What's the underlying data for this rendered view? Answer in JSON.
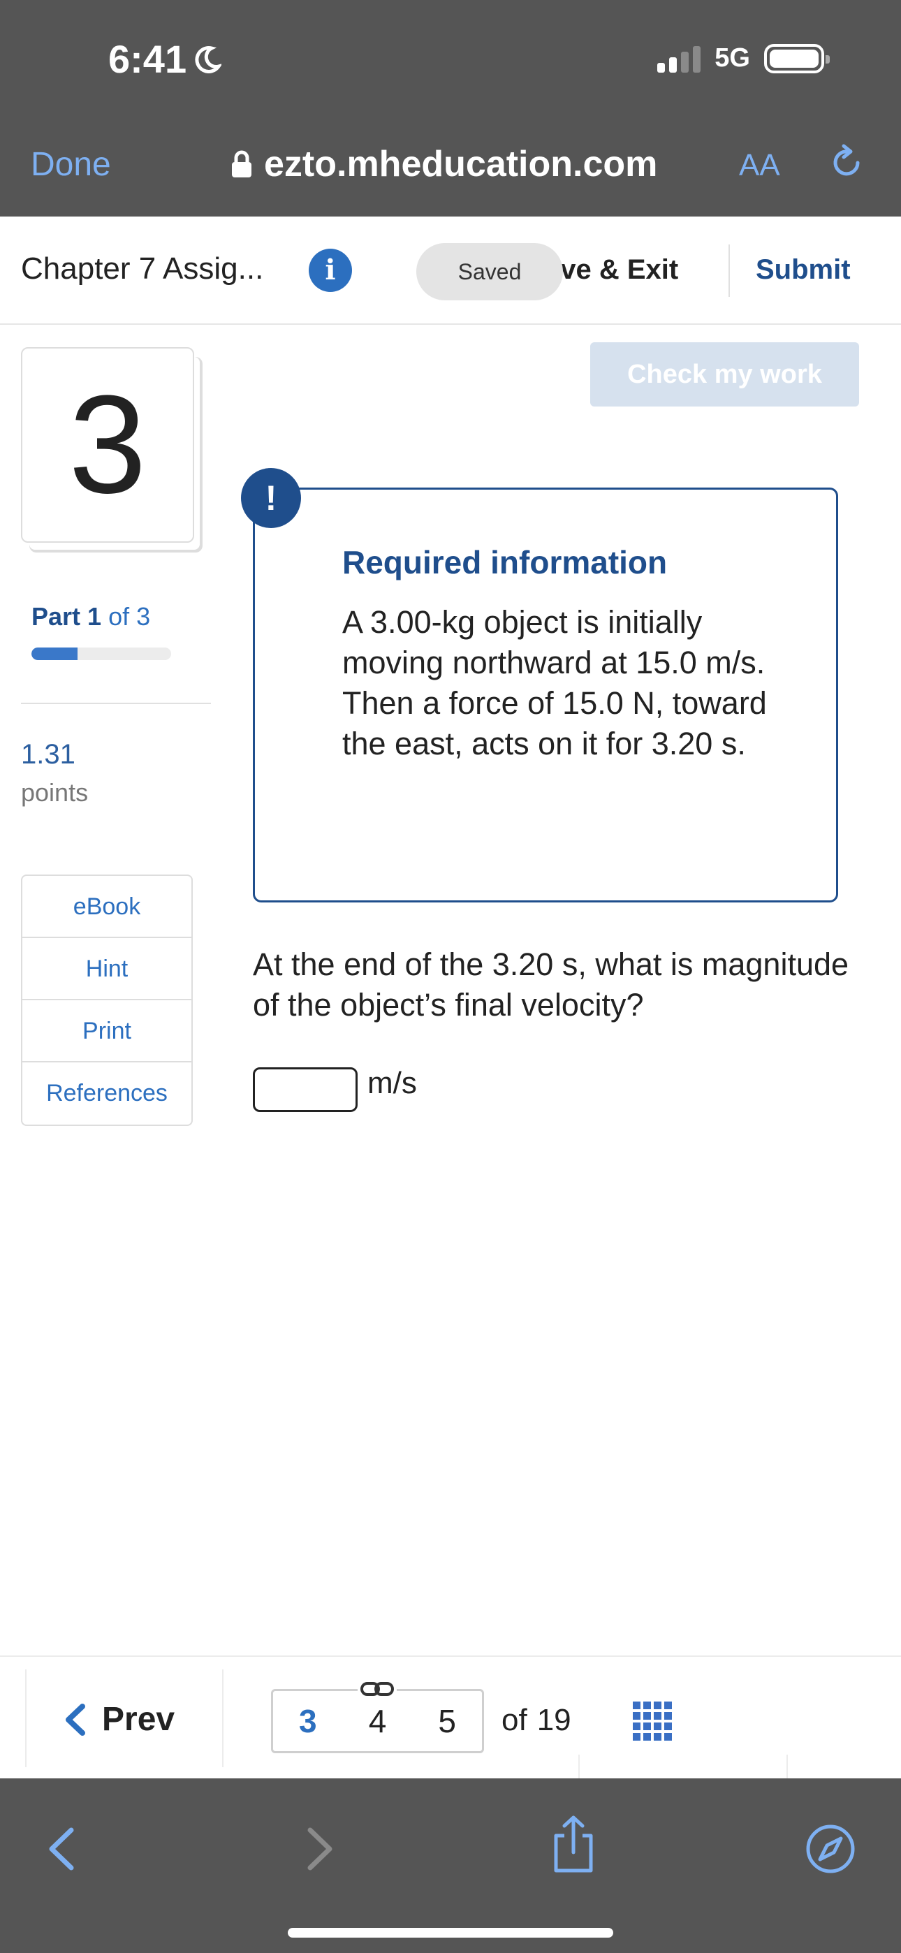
{
  "status_bar": {
    "time": "6:41",
    "network": "5G"
  },
  "browser": {
    "done_label": "Done",
    "url": "ezto.mheducation.com",
    "text_size_label": "AA"
  },
  "header": {
    "title": "Chapter 7 Assig...",
    "saved_label": "Saved",
    "save_exit_label": "ave & Exit",
    "submit_label": "Submit"
  },
  "question_nav": {
    "number": "3",
    "part_label": "Part",
    "part_current": "1",
    "part_of": "of 3",
    "part_progress": 0.33,
    "points_value": "1.31",
    "points_label": "points"
  },
  "tools": [
    "eBook",
    "Hint",
    "Print",
    "References"
  ],
  "check_work_label": "Check my work",
  "required": {
    "badge": "!",
    "title": "Required information",
    "text": "A 3.00-kg object is initially moving northward at 15.0 m/s. Then a force of 15.0 N, toward the east, acts on it for 3.20 s."
  },
  "question": {
    "text": "At the end of the 3.20 s, what is magnitude of the object’s final velocity?",
    "answer_value": "",
    "unit": "m/s"
  },
  "pager": {
    "prev_label": "Prev",
    "pages": [
      "3",
      "4",
      "5"
    ],
    "of_label": "of",
    "total": "19"
  },
  "colors": {
    "accent": "#1f4e8c",
    "link": "#2c6fbf",
    "chrome": "#555555"
  }
}
